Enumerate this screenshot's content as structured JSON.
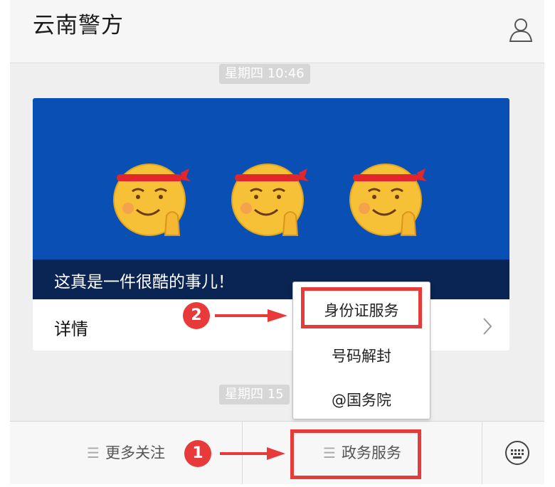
{
  "header": {
    "title": "云南警方",
    "profile_icon": "person-outline-icon"
  },
  "chat": {
    "timestamp_1": "星期四 10:46",
    "timestamp_2": "星期四 15",
    "card": {
      "caption": "这真是一件很酷的事儿！",
      "details_label": "详情",
      "chevron_icon": "chevron-right-icon"
    }
  },
  "popup_menu": {
    "items": [
      {
        "label": "身份证服务"
      },
      {
        "label": "号码解封"
      },
      {
        "label": "@国务院"
      }
    ]
  },
  "bottom_bar": {
    "tab_1": {
      "icon": "menu-lines-icon",
      "label": "更多关注"
    },
    "tab_2": {
      "icon": "menu-lines-icon",
      "label": "政务服务"
    },
    "keyboard_icon": "keyboard-icon"
  },
  "annotations": {
    "step_1": "1",
    "step_2": "2",
    "highlight_color": "#e53b3b"
  },
  "colors": {
    "banner_blue": "#0a4fb3",
    "caption_navy": "#0a2453",
    "chat_bg": "#efefef"
  }
}
